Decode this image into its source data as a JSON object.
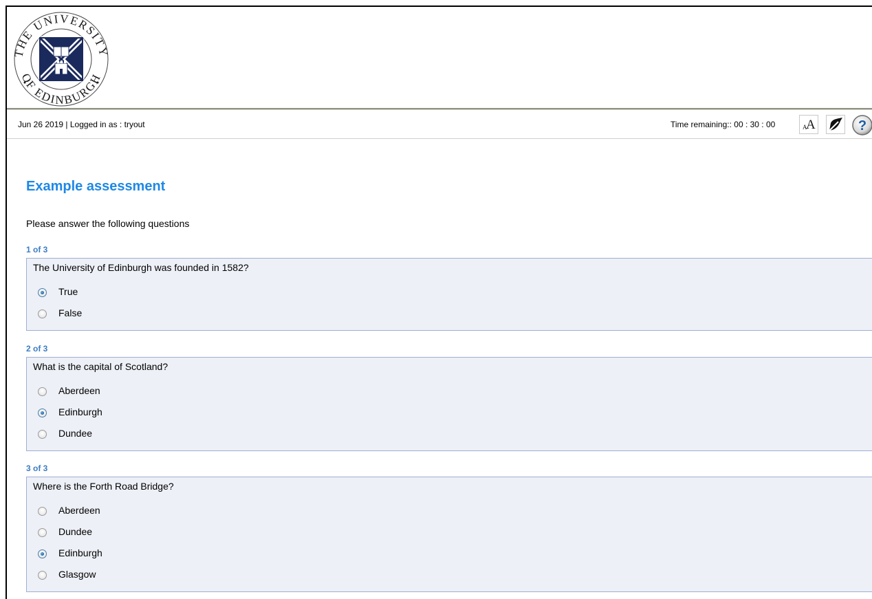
{
  "header": {
    "logo_alt": "The University of Edinburgh",
    "logo_top_text": "THE UNIVERSITY",
    "logo_bottom_text": "OF EDINBURGH"
  },
  "status": {
    "date": "Jun 26 2019",
    "separator": "|",
    "login_label": "Logged in as :",
    "username": "tryout",
    "time_label": "Time remaining::",
    "time_value": "00 : 30 : 00"
  },
  "tools": {
    "font_small": "A",
    "font_big": "A",
    "font_icon": "font-size-icon",
    "contrast_icon": "contrast-icon",
    "help_icon": "help-icon",
    "help_glyph": "?"
  },
  "page": {
    "title": "Example assessment",
    "intro": "Please answer the following questions"
  },
  "questions": [
    {
      "number": "1  of 3",
      "text": "The University of Edinburgh was founded in 1582?",
      "options": [
        {
          "label": "True",
          "selected": true
        },
        {
          "label": "False",
          "selected": false
        }
      ]
    },
    {
      "number": "2  of 3",
      "text": "What is the capital of Scotland?",
      "options": [
        {
          "label": "Aberdeen",
          "selected": false
        },
        {
          "label": "Edinburgh",
          "selected": true
        },
        {
          "label": "Dundee",
          "selected": false
        }
      ]
    },
    {
      "number": "3  of 3",
      "text": "Where is the Forth Road Bridge?",
      "options": [
        {
          "label": "Aberdeen",
          "selected": false
        },
        {
          "label": "Dundee",
          "selected": false
        },
        {
          "label": "Edinburgh",
          "selected": true
        },
        {
          "label": "Glasgow",
          "selected": false
        }
      ]
    }
  ],
  "colors": {
    "title": "#1e88e5",
    "question_number": "#3b7cc4",
    "question_bg": "#edf0f7",
    "question_border": "#9eaed3",
    "logo_navy": "#1b2a5c"
  }
}
